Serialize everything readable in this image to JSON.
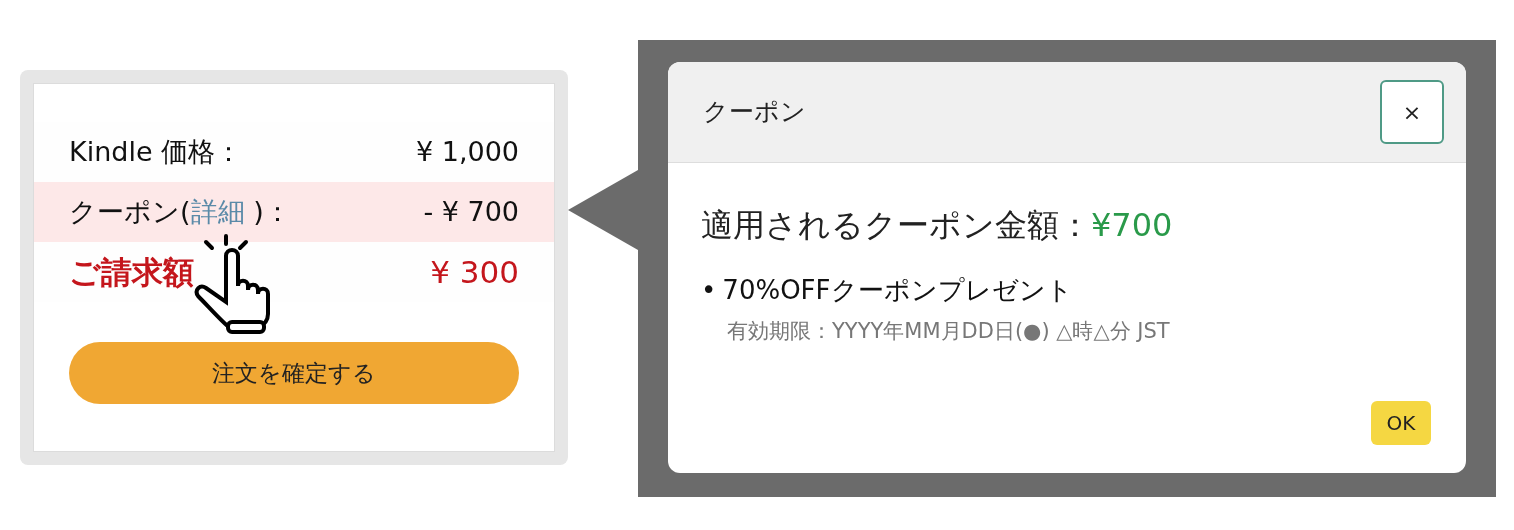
{
  "summary": {
    "rows": [
      {
        "kind": "price",
        "label": "Kindle 価格：",
        "value": "¥ 1,000",
        "highlighted": false
      },
      {
        "kind": "coupon",
        "label": "クーポン(",
        "link": "詳細",
        "label_end": " )：",
        "value": "- ¥ 700",
        "highlighted": true
      },
      {
        "kind": "total",
        "label": "ご請求額",
        "value": "¥ 300",
        "highlighted": false
      }
    ],
    "button": "注文を確定する"
  },
  "dialog": {
    "title": "クーポン",
    "close": "×",
    "heading": "適用されるクーポン金額：",
    "amount": "¥700",
    "items": [
      {
        "bullet": "•",
        "text": "70%OFFクーポンプレゼント",
        "expiry": "有効期限：YYYY年MM月DD日(●) △時△分 JST"
      }
    ],
    "ok": "OK"
  }
}
